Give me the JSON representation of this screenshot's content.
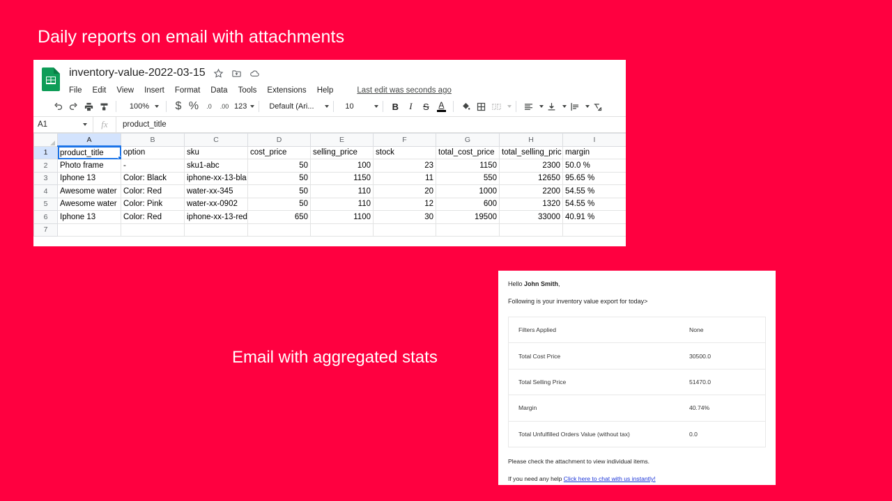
{
  "slide": {
    "title": "Daily reports on email with attachments",
    "caption": "Email with aggregated stats",
    "background_color": "#FF0040",
    "title_color": "#FFFFFF"
  },
  "sheets": {
    "logo_icon": "google-sheets-icon",
    "doc_title": "inventory-value-2022-03-15",
    "title_icons": [
      "star-icon",
      "move-to-folder-icon",
      "cloud-saved-icon"
    ],
    "menu_items": [
      "File",
      "Edit",
      "View",
      "Insert",
      "Format",
      "Data",
      "Tools",
      "Extensions",
      "Help"
    ],
    "last_edit": "Last edit was seconds ago",
    "toolbar": {
      "undo_icon": "undo-icon",
      "redo_icon": "redo-icon",
      "print_icon": "print-icon",
      "paint_icon": "paint-format-icon",
      "zoom_level": "100%",
      "currency": "$",
      "percent": "%",
      "decrease_decimal": ".0",
      "increase_decimal": ".00",
      "number_format": "123",
      "font_family": "Default (Ari...",
      "font_size": "10",
      "bold": "B",
      "italic": "I",
      "strikethrough": "S",
      "text_color": "A",
      "fill_color_icon": "fill-color-icon",
      "borders_icon": "borders-icon",
      "merge_icon": "merge-cells-icon",
      "halign_icon": "horizontal-align-icon",
      "valign_icon": "vertical-align-icon",
      "wrap_icon": "text-wrap-icon",
      "rotate_icon": "text-rotation-icon"
    },
    "name_box": "A1",
    "fx_label": "fx",
    "formula_value": "product_title",
    "column_headers": [
      "A",
      "B",
      "C",
      "D",
      "E",
      "F",
      "G",
      "H",
      "I"
    ],
    "selected_cell": "A1",
    "row_numbers": [
      "1",
      "2",
      "3",
      "4",
      "5",
      "6",
      "7"
    ],
    "header_row": [
      "product_title",
      "option",
      "sku",
      "cost_price",
      "selling_price",
      "stock",
      "total_cost_price",
      "total_selling_pric",
      "margin"
    ],
    "rows": [
      [
        "Photo frame",
        "-",
        "sku1-abc",
        "50",
        "100",
        "23",
        "1150",
        "2300",
        "50.0 %"
      ],
      [
        "Iphone 13",
        "Color: Black",
        "iphone-xx-13-bla",
        "50",
        "1150",
        "11",
        "550",
        "12650",
        "95.65 %"
      ],
      [
        "Awesome water",
        "Color: Red",
        "water-xx-345",
        "50",
        "110",
        "20",
        "1000",
        "2200",
        "54.55 %"
      ],
      [
        "Awesome water",
        "Color: Pink",
        "water-xx-0902",
        "50",
        "110",
        "12",
        "600",
        "1320",
        "54.55 %"
      ],
      [
        "Iphone 13",
        "Color: Red",
        "iphone-xx-13-red",
        "650",
        "1100",
        "30",
        "19500",
        "33000",
        "40.91 %"
      ],
      [
        "",
        "",
        "",
        "",
        "",
        "",
        "",
        "",
        ""
      ]
    ]
  },
  "email": {
    "greeting_prefix": "Hello ",
    "recipient_name": "John Smith",
    "greeting_suffix": ",",
    "intro": "Following is your inventory value export for today>",
    "stats": [
      {
        "label": "Filters Applied",
        "value": "None"
      },
      {
        "label": "Total Cost Price",
        "value": "30500.0"
      },
      {
        "label": "Total Selling Price",
        "value": "51470.0"
      },
      {
        "label": "Margin",
        "value": "40.74%"
      },
      {
        "label": "Total Unfulfilled Orders Value (without tax)",
        "value": "0.0"
      }
    ],
    "footer_note": "Please check the attachment to view individual items.",
    "help_prefix": "If you need any help ",
    "help_link": "Click here to chat with us instantly!",
    "link_color": "#1a34d8"
  }
}
